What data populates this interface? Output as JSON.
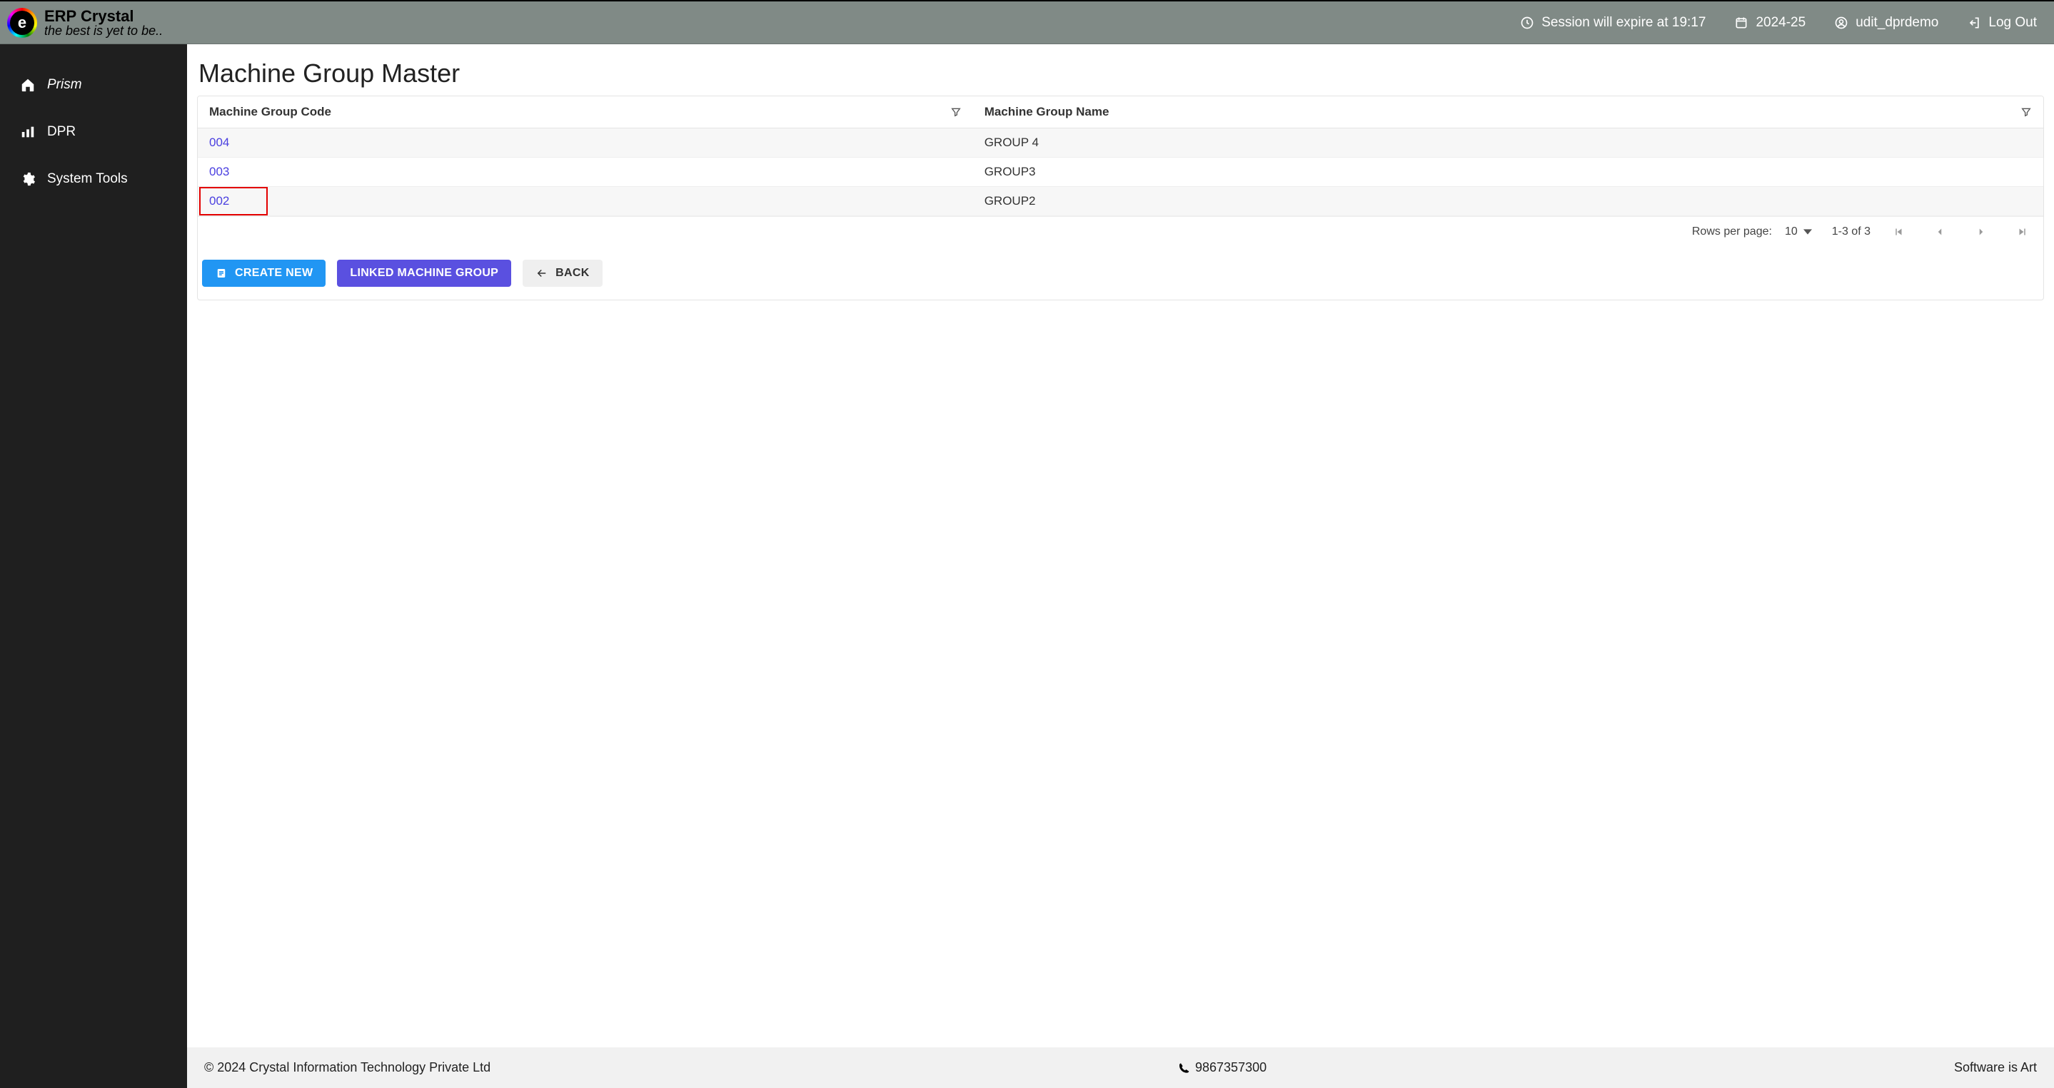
{
  "brand": {
    "title": "ERP Crystal",
    "tagline": "the best is yet to be.."
  },
  "topbar": {
    "session_text": "Session will expire at 19:17",
    "fy_label": "2024-25",
    "user_label": "udit_dprdemo",
    "logout_label": "Log Out"
  },
  "sidebar": {
    "items": [
      {
        "label": "Prism"
      },
      {
        "label": "DPR"
      },
      {
        "label": "System Tools"
      }
    ]
  },
  "page": {
    "title": "Machine Group Master"
  },
  "table": {
    "columns": [
      {
        "header": "Machine Group Code"
      },
      {
        "header": "Machine Group Name"
      }
    ],
    "rows": [
      {
        "code": "004",
        "name": "GROUP 4",
        "highlight": false
      },
      {
        "code": "003",
        "name": "GROUP3",
        "highlight": false
      },
      {
        "code": "002",
        "name": "GROUP2",
        "highlight": true
      }
    ],
    "pagination": {
      "rows_per_page_label": "Rows per page:",
      "rows_per_page_value": "10",
      "range_text": "1-3 of 3"
    }
  },
  "actions": {
    "create_label": "CREATE NEW",
    "linked_label": "LINKED MACHINE GROUP",
    "back_label": "BACK"
  },
  "footer": {
    "copyright": "© 2024 Crystal Information Technology Private Ltd",
    "phone": "9867357300",
    "art": "Software is Art"
  }
}
